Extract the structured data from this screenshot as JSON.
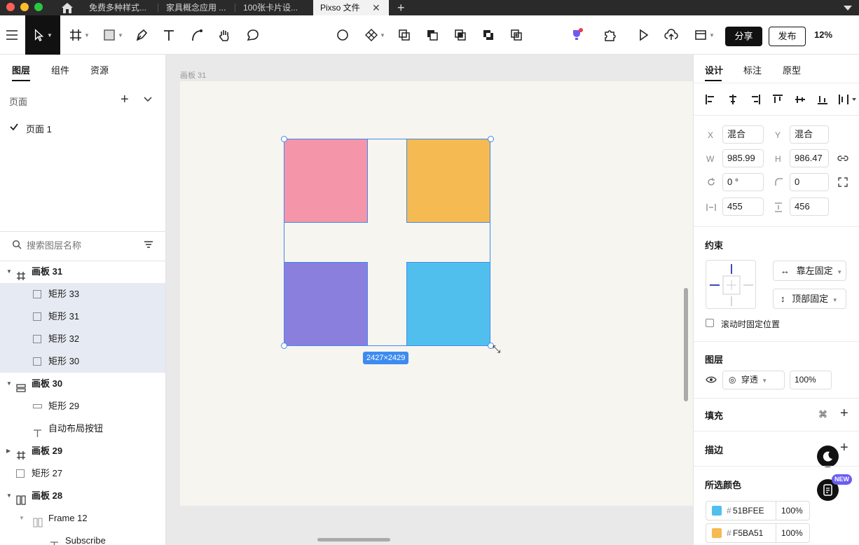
{
  "tabs": [
    {
      "label": "免费多种样式..."
    },
    {
      "label": "家具概念应用 ..."
    },
    {
      "label": "100张卡片设..."
    },
    {
      "label": "Pixso 文件",
      "active": true
    }
  ],
  "toolbar": {
    "share_label": "分享",
    "publish_label": "发布",
    "zoom": "12%"
  },
  "left_panel": {
    "tabs": [
      "图层",
      "组件",
      "资源"
    ],
    "pages_label": "页面",
    "current_page": "页面 1",
    "search_placeholder": "搜索图层名称",
    "layers": [
      {
        "name": "画板 31",
        "type": "frame",
        "indent": 0,
        "bold": true,
        "expanded": true
      },
      {
        "name": "矩形 33",
        "type": "rect",
        "indent": 1,
        "selected": true
      },
      {
        "name": "矩形 31",
        "type": "rect",
        "indent": 1,
        "selected": true
      },
      {
        "name": "矩形 32",
        "type": "rect",
        "indent": 1,
        "selected": true
      },
      {
        "name": "矩形 30",
        "type": "rect",
        "indent": 1,
        "selected": true
      },
      {
        "name": "画板 30",
        "type": "autolayout",
        "indent": 0,
        "bold": true,
        "expanded": true
      },
      {
        "name": "矩形 29",
        "type": "rect-h",
        "indent": 1
      },
      {
        "name": "自动布局按钮",
        "type": "text",
        "indent": 1
      },
      {
        "name": "画板 29",
        "type": "frame",
        "indent": 0,
        "bold": true,
        "collapsed": true
      },
      {
        "name": "矩形 27",
        "type": "rect",
        "indent": 0
      },
      {
        "name": "画板 28",
        "type": "columns",
        "indent": 0,
        "bold": true,
        "expanded": true
      },
      {
        "name": "Frame 12",
        "type": "columns",
        "indent": 1,
        "expanded": true
      },
      {
        "name": "Subscribe",
        "type": "text",
        "indent": 2
      }
    ]
  },
  "canvas": {
    "artboard_label": "画板 31",
    "dimension_badge": "2427×2429",
    "colors": {
      "pink": "#F595A9",
      "orange": "#F5BA51",
      "purple": "#8B7FDD",
      "blue": "#51BFEE",
      "selection": "#3D8BF0"
    }
  },
  "right_panel": {
    "tabs": [
      "设计",
      "标注",
      "原型"
    ],
    "x_label": "X",
    "x_value": "混合",
    "y_label": "Y",
    "y_value": "混合",
    "w_label": "W",
    "w_value": "985.99",
    "h_label": "H",
    "h_value": "986.47",
    "rotation_value": "0 °",
    "radius_value": "0",
    "spacing_h_value": "455",
    "spacing_v_value": "456",
    "constraints_label": "约束",
    "constraint_h": "靠左固定",
    "constraint_v": "顶部固定",
    "fixed_scroll_label": "滚动时固定位置",
    "layer_label": "图层",
    "blend_mode": "穿透",
    "opacity": "100%",
    "fill_label": "填充",
    "stroke_label": "描边",
    "selected_colors_label": "所选颜色",
    "new_badge": "NEW",
    "selected_colors": [
      {
        "hex": "51BFEE",
        "color": "#51BFEE",
        "opacity": "100%"
      },
      {
        "hex": "F5BA51",
        "color": "#F5BA51",
        "opacity": "100%"
      }
    ]
  }
}
